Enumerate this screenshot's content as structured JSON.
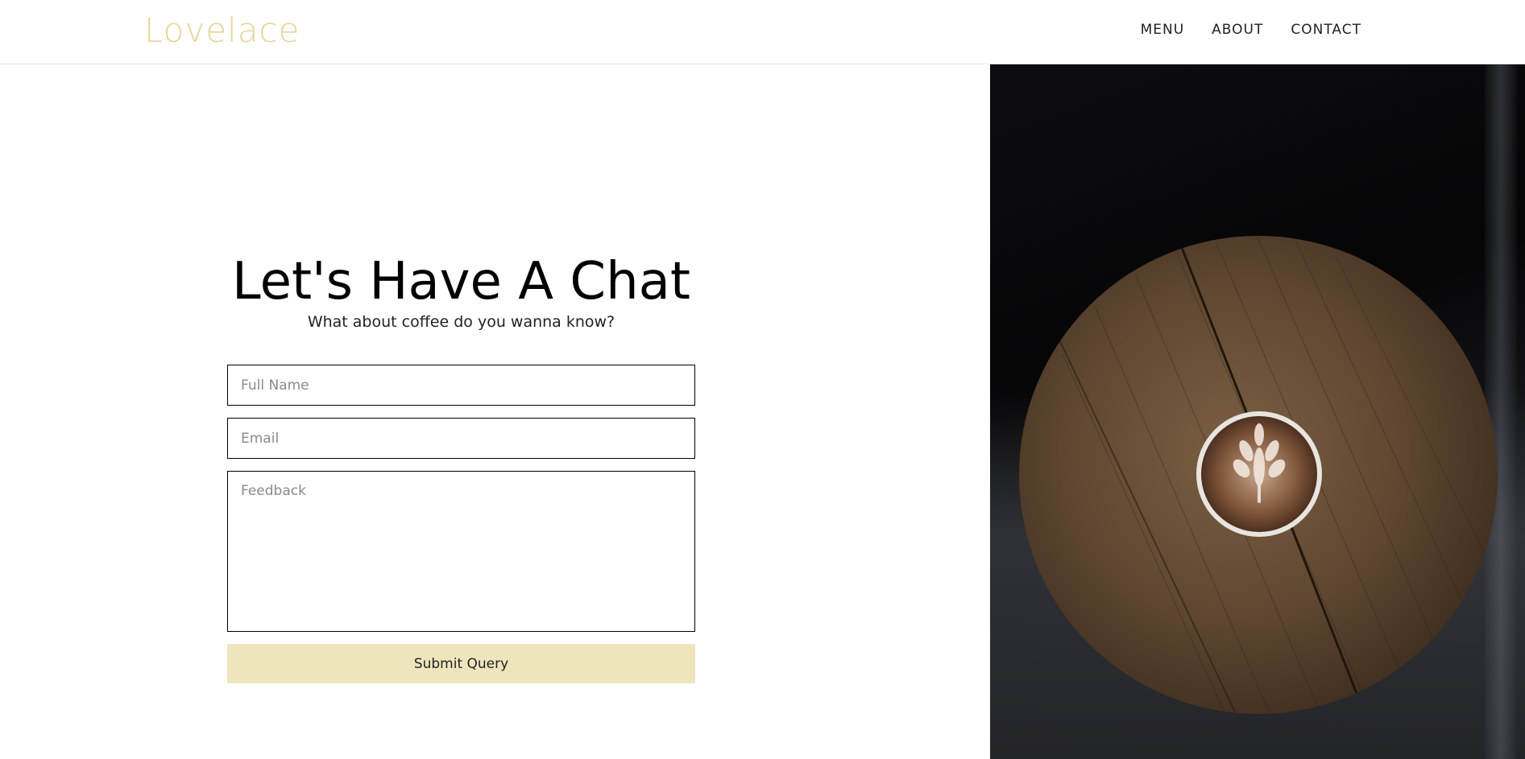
{
  "header": {
    "logo": "Lovelace",
    "nav": [
      {
        "label": "MENU"
      },
      {
        "label": "ABOUT"
      },
      {
        "label": "CONTACT"
      }
    ]
  },
  "main": {
    "title": "Let's Have A Chat",
    "subtitle": "What about coffee do you wanna know?",
    "form": {
      "name_placeholder": "Full Name",
      "email_placeholder": "Email",
      "feedback_placeholder": "Feedback",
      "submit_label": "Submit Query"
    }
  },
  "colors": {
    "logo": "#e6d59a",
    "submit_bg": "#efe5bd"
  },
  "icons": {
    "hero_image": "coffee-latte-on-round-wooden-table"
  }
}
